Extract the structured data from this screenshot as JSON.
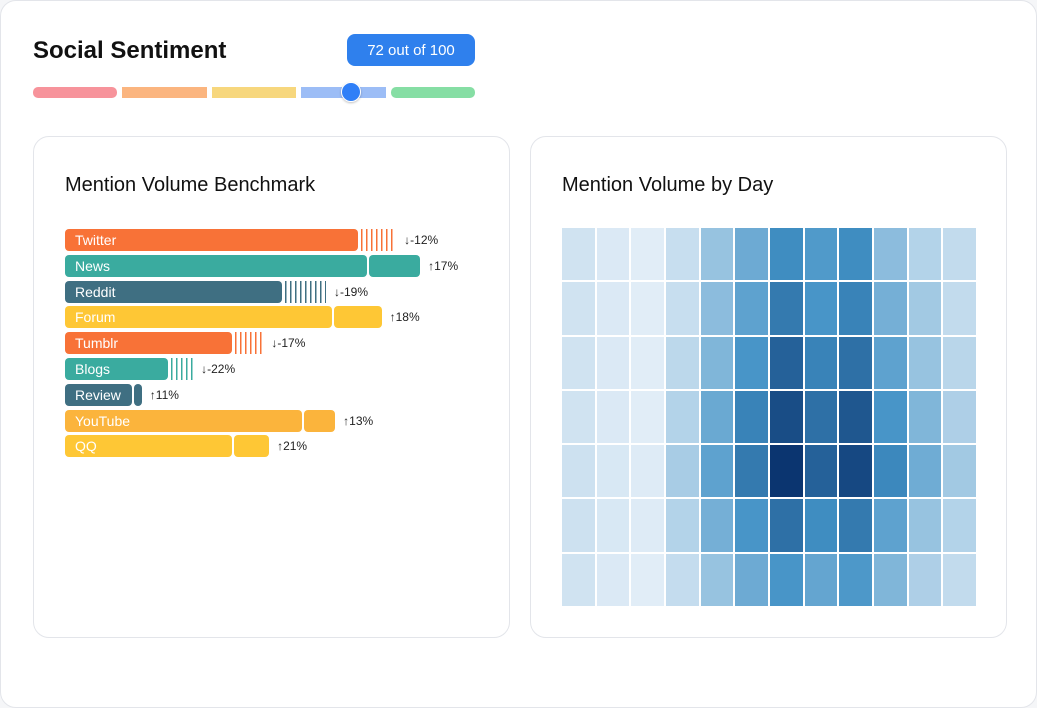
{
  "header": {
    "title": "Social Sentiment",
    "score_label": "72 out of 100",
    "score": 72,
    "score_max": 100
  },
  "colors": {
    "accent": "#2f80ed",
    "scale": [
      "#f7939b",
      "#fbb57f",
      "#f7d77d",
      "#9cbdf6",
      "#86dea4"
    ],
    "twitter": "#f87237",
    "news": "#3aab9f",
    "reddit": "#3f6f82",
    "forum": "#fec735",
    "tumblr": "#f87237",
    "blogs": "#3aab9f",
    "review": "#3f6f82",
    "youtube": "#fbb43c",
    "qq": "#fec735"
  },
  "benchmark": {
    "title": "Mention Volume Benchmark",
    "chart_data": {
      "type": "bar",
      "categories": [
        "Twitter",
        "News",
        "Reddit",
        "Forum",
        "Tumblr",
        "Blogs",
        "Review",
        "YouTube",
        "QQ"
      ],
      "values": [
        100,
        103,
        74,
        91,
        57,
        35,
        23,
        81,
        57
      ],
      "changes": [
        -12,
        17,
        -19,
        18,
        -17,
        -22,
        11,
        13,
        21
      ],
      "change_labels": [
        "↓-12%",
        "↑17%",
        "↓-19%",
        "↑18%",
        "↓-17%",
        "↓-22%",
        "↑11%",
        "↑13%",
        "↑21%"
      ]
    }
  },
  "heatmap": {
    "title": "Mention Volume by Day",
    "chart_data": {
      "type": "heatmap",
      "rows": 7,
      "cols": 12,
      "values": [
        [
          0.1,
          0.06,
          0.04,
          0.13,
          0.3,
          0.45,
          0.62,
          0.55,
          0.62,
          0.34,
          0.2,
          0.15
        ],
        [
          0.1,
          0.06,
          0.04,
          0.13,
          0.34,
          0.5,
          0.7,
          0.58,
          0.66,
          0.42,
          0.26,
          0.15
        ],
        [
          0.1,
          0.06,
          0.04,
          0.17,
          0.38,
          0.58,
          0.8,
          0.66,
          0.74,
          0.5,
          0.3,
          0.18
        ],
        [
          0.1,
          0.06,
          0.04,
          0.2,
          0.46,
          0.66,
          0.88,
          0.74,
          0.84,
          0.58,
          0.38,
          0.22
        ],
        [
          0.11,
          0.07,
          0.05,
          0.24,
          0.5,
          0.7,
          0.98,
          0.8,
          0.9,
          0.64,
          0.44,
          0.26
        ],
        [
          0.11,
          0.07,
          0.05,
          0.2,
          0.42,
          0.58,
          0.74,
          0.62,
          0.7,
          0.5,
          0.3,
          0.2
        ],
        [
          0.1,
          0.06,
          0.04,
          0.14,
          0.3,
          0.45,
          0.58,
          0.48,
          0.56,
          0.38,
          0.22,
          0.15
        ]
      ]
    }
  }
}
